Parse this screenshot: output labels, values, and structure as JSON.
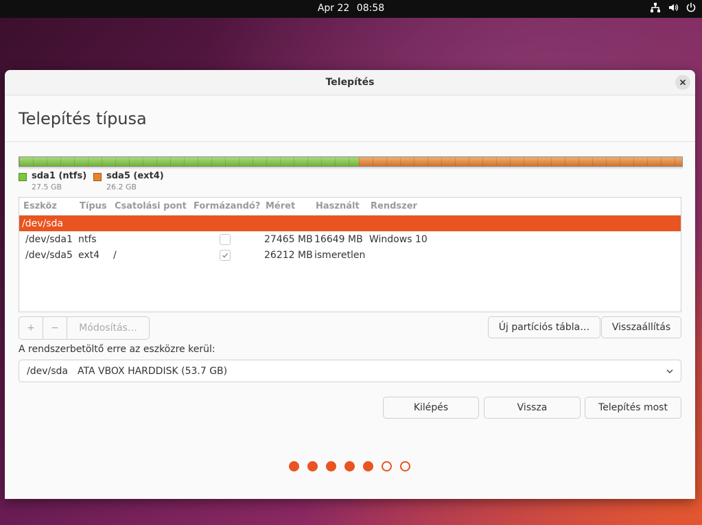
{
  "topbar": {
    "date": "Apr 22",
    "time": "08:58",
    "icons": [
      "network-icon",
      "volume-icon",
      "power-icon"
    ]
  },
  "window": {
    "title": "Telepítés",
    "close_icon": "close-icon"
  },
  "page": {
    "title": "Telepítés típusa"
  },
  "partition_bar": {
    "segments": [
      {
        "name": "sda1 (ntfs)",
        "size": "27.5 GB",
        "color": "#7cc73a",
        "fraction": 0.512
      },
      {
        "name": "sda5 (ext4)",
        "size": "26.2 GB",
        "color": "#e9822b",
        "fraction": 0.488
      }
    ]
  },
  "table": {
    "headers": [
      "Eszköz",
      "Típus",
      "Csatolási pont",
      "Formázandó?",
      "Méret",
      "Használt",
      "Rendszer"
    ],
    "disk_row": "/dev/sda",
    "rows": [
      {
        "device": "/dev/sda1",
        "type": "ntfs",
        "mount": "",
        "format": false,
        "size": "27465 MB",
        "used": "16649 MB",
        "system": "Windows 10"
      },
      {
        "device": "/dev/sda5",
        "type": "ext4",
        "mount": "/",
        "format": true,
        "size": "26212 MB",
        "used": "ismeretlen",
        "system": ""
      }
    ]
  },
  "toolbar": {
    "add": "+",
    "remove": "−",
    "change": "Módosítás…",
    "new_table": "Új partíciós tábla…",
    "revert": "Visszaállítás"
  },
  "bootloader": {
    "label": "A rendszerbetöltő erre az eszközre kerül:",
    "device": "/dev/sda",
    "description": "ATA VBOX HARDDISK (53.7 GB)"
  },
  "buttons": {
    "quit": "Kilépés",
    "back": "Vissza",
    "install": "Telepítés most"
  },
  "progress": {
    "completed_steps": 5,
    "total_steps": 7
  },
  "colors": {
    "accent": "#e95420",
    "ntfs": "#7cc73a",
    "ext4": "#e9822b"
  }
}
